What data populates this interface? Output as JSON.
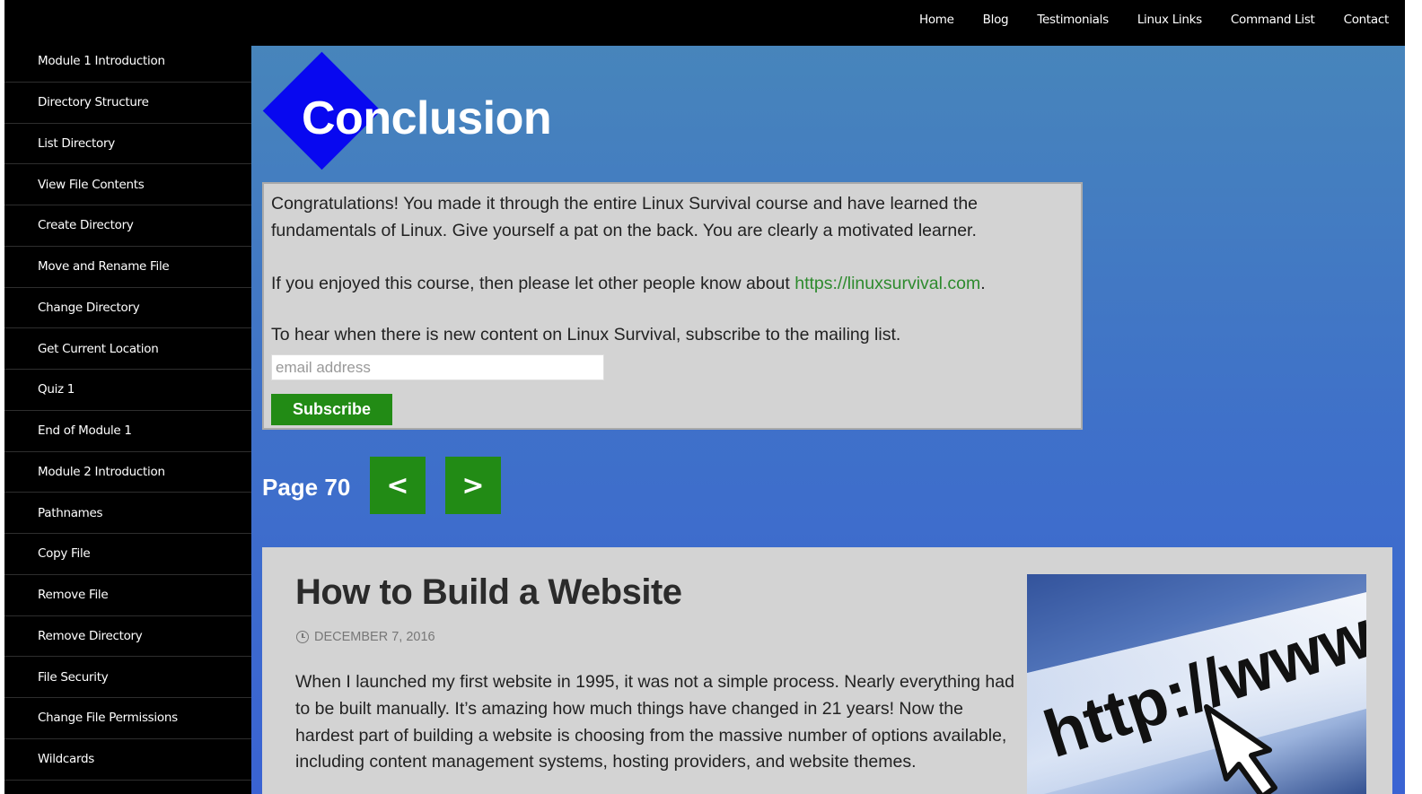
{
  "topnav": {
    "items": [
      "Home",
      "Blog",
      "Testimonials",
      "Linux Links",
      "Command List",
      "Contact"
    ]
  },
  "sidebar": {
    "items": [
      "Module 1 Introduction",
      "Directory Structure",
      "List Directory",
      "View File Contents",
      "Create Directory",
      "Move and Rename File",
      "Change Directory",
      "Get Current Location",
      "Quiz 1",
      "End of Module 1",
      "Module 2 Introduction",
      "Pathnames",
      "Copy File",
      "Remove File",
      "Remove Directory",
      "File Security",
      "Change File Permissions",
      "Wildcards"
    ]
  },
  "logo": {
    "text": "Conclusion"
  },
  "content": {
    "congrats": "Congratulations! You made it through the entire Linux Survival course and have learned the fundamentals of Linux. Give yourself a pat on the back. You are clearly a motivated learner.",
    "share_prefix": "If you enjoyed this course, then please let other people know about ",
    "share_link": "https://linuxsurvival.com",
    "share_suffix": ".",
    "subscribe_text": "To hear when there is new content on Linux Survival, subscribe to the mailing list.",
    "email_placeholder": "email address",
    "subscribe_button": "Subscribe"
  },
  "pager": {
    "label": "Page 70",
    "prev": "<",
    "next": ">"
  },
  "article": {
    "title": "How to Build a Website",
    "date": "DECEMBER 7, 2016",
    "text": "When I launched my first website in 1995, it was not a simple process. Nearly everything had to be built manually. It’s amazing how much things have changed in 21 years! Now the hardest part of building a website is choosing from the massive number of options available, including content management systems, hosting providers, and website themes.",
    "image_text": "http://www"
  },
  "colors": {
    "nav_background": "#000000",
    "main_gradient_top": "#4785bb",
    "main_gradient_bottom": "#3a63d3",
    "button_green": "#228b15",
    "link_green": "#2d8a2d",
    "logo_diamond": "#0808f0",
    "content_grey": "#d3d3d3"
  }
}
